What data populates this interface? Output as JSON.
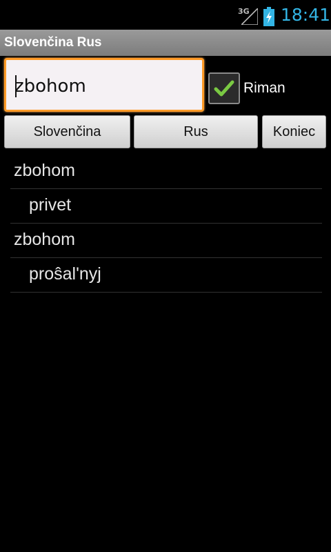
{
  "status_bar": {
    "network": "3G",
    "time": "18:41",
    "clock_color": "#33b5e5"
  },
  "title_bar": {
    "title": "Slovenčina Rus"
  },
  "search": {
    "value": "zbohom",
    "focus_color": "#ff9a26"
  },
  "checkbox": {
    "label": "Riman",
    "checked": true,
    "check_color": "#7ac943"
  },
  "buttons": {
    "slovencina": "Slovenčina",
    "rus": "Rus",
    "koniec": "Koniec"
  },
  "results": [
    {
      "text": "zbohom",
      "kind": "word"
    },
    {
      "text": "privet",
      "kind": "translation"
    },
    {
      "text": "zbohom",
      "kind": "word"
    },
    {
      "text": "proŝal'nyj",
      "kind": "translation"
    }
  ],
  "icons": {
    "signal": "signal-icon",
    "battery": "battery-charging-icon",
    "check": "check-icon"
  }
}
